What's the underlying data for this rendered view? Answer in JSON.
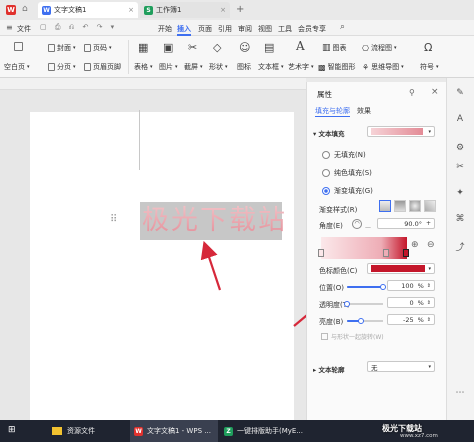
{
  "tabbar": {
    "home_icon": "home-icon",
    "tabs": [
      {
        "label": "文字文稿1",
        "icon": "wps-writer-icon"
      },
      {
        "label": "工作簿1",
        "icon": "wps-sheet-icon"
      }
    ],
    "new_tab": "+"
  },
  "menubar": {
    "file": "文件",
    "items": [
      "开始",
      "插入",
      "页面",
      "引用",
      "审阅",
      "视图",
      "工具",
      "会员专享"
    ],
    "active": "插入"
  },
  "ribbon": {
    "row1": {
      "cover": "封面",
      "pageno": "页码",
      "table": "表格",
      "image": "图片",
      "screenshot": "截屏",
      "shape": "形状",
      "icon": "图标",
      "textbox": "文本框",
      "arttext": "艺术字",
      "chart": "图表",
      "smartgraph": "智能图形",
      "flowchart": "流程图",
      "mindmap": "思维导图",
      "symbol": "符号"
    },
    "row2": {
      "blankpage": "空白页",
      "section": "分页",
      "header_footer": "页眉页脚"
    }
  },
  "document": {
    "text": "极光下载站"
  },
  "panel": {
    "title": "属性",
    "tabs": [
      "填充与轮廓",
      "效果"
    ],
    "text_fill": {
      "label": "文本填充",
      "color": "#e8a0a8"
    },
    "options": [
      {
        "label": "无填充(N)",
        "selected": false
      },
      {
        "label": "纯色填充(S)",
        "selected": false
      },
      {
        "label": "渐变填充(G)",
        "selected": true
      }
    ],
    "gradient_style_label": "渐变样式(R)",
    "angle_label": "角度(E)",
    "angle_value": "90.0",
    "angle_unit": "°",
    "stop_color_label": "色标颜色(C)",
    "stop_color": "#c4162a",
    "position": {
      "label": "位置(O)",
      "value": "100",
      "unit": "%",
      "level": 1.0
    },
    "transparency": {
      "label": "透明度(T)",
      "value": "0",
      "unit": "%",
      "level": 0.0
    },
    "brightness": {
      "label": "亮度(B)",
      "value": "-25",
      "unit": "%",
      "level": 0.38
    },
    "rotate_with_shape": "与形状一起旋转(W)",
    "text_outline": {
      "label": "文本轮廓",
      "value": "无"
    }
  },
  "taskbar": {
    "items": [
      {
        "label": "资源文件",
        "icon": "folder-icon"
      },
      {
        "label": "文字文稿1 - WPS ...",
        "icon": "wps-icon"
      },
      {
        "label": "一键排版助手(MyE...",
        "icon": "app-icon"
      }
    ],
    "watermark": "极光下载站",
    "watermark_url": "www.xz7.com"
  },
  "colors": {
    "accent": "#3e6ff0",
    "wps_red": "#e0312d",
    "sheet_green": "#1f9e5c",
    "arrow_red": "#d6283a"
  }
}
